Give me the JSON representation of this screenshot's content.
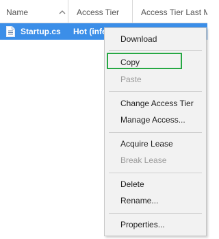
{
  "columns": {
    "name": "Name",
    "access_tier": "Access Tier",
    "access_tier_last_modified": "Access Tier Last M"
  },
  "file": {
    "name": "Startup.cs",
    "access_tier": "Hot (infe",
    "icon": "file-icon"
  },
  "context_menu": {
    "download": "Download",
    "copy": "Copy",
    "paste": "Paste",
    "change_access_tier": "Change Access Tier",
    "manage_access": "Manage Access...",
    "acquire_lease": "Acquire Lease",
    "break_lease": "Break Lease",
    "delete": "Delete",
    "rename": "Rename...",
    "properties": "Properties..."
  },
  "colors": {
    "selection": "#3b8ee8",
    "highlight_box": "#27a844",
    "disabled_text": "#9a9a9a",
    "menu_background": "#f2f2f2"
  }
}
